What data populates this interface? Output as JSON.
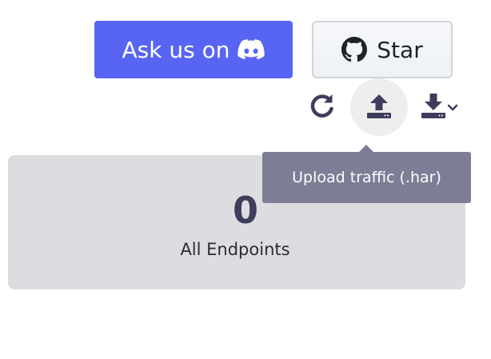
{
  "header": {
    "discord_button_label": "Ask us on",
    "discord_icon": "discord-icon",
    "star_button_label": "Star",
    "star_icon": "github-icon"
  },
  "toolbar": {
    "refresh_icon": "refresh-icon",
    "upload_icon": "upload-icon",
    "download_icon": "download-icon",
    "download_dropdown_icon": "chevron-down-icon"
  },
  "tooltip": {
    "text": "Upload traffic (.har)"
  },
  "card": {
    "count": "0",
    "label": "All Endpoints"
  },
  "colors": {
    "discord": "#5865f2",
    "card_bg": "#dddde1",
    "tooltip_bg": "#7d7d96",
    "icon": "#3f3d5c"
  }
}
